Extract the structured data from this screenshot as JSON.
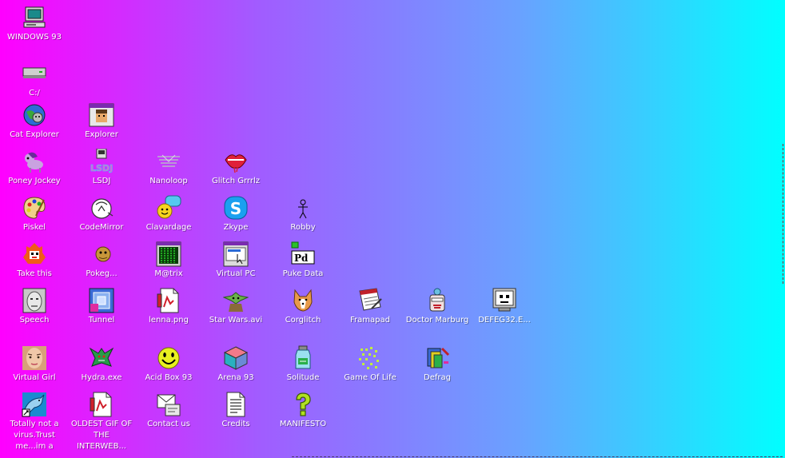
{
  "desktop": {
    "icons": [
      {
        "name": "WINDOWS 93",
        "icon": "computer-icon"
      },
      {
        "name": "C:/",
        "icon": "drive-icon"
      },
      {
        "name": "Cat Explorer",
        "icon": "cat-globe-icon"
      },
      {
        "name": "Explorer",
        "icon": "explorer-window-icon"
      },
      {
        "name": "Poney Jockey",
        "icon": "pony-icon"
      },
      {
        "name": "LSDJ",
        "icon": "gameboy-icon"
      },
      {
        "name": "Nanoloop",
        "icon": "nanoloop-icon"
      },
      {
        "name": "Glitch Grrrlz",
        "icon": "lips-icon"
      },
      {
        "name": "Piskel",
        "icon": "palette-icon"
      },
      {
        "name": "CodeMirror",
        "icon": "codemirror-icon"
      },
      {
        "name": "Clavardage",
        "icon": "chat-smiley-icon"
      },
      {
        "name": "Zkype",
        "icon": "zkype-icon"
      },
      {
        "name": "Robby",
        "icon": "robot-stick-icon"
      },
      {
        "name": "Take this",
        "icon": "fire-creature-icon"
      },
      {
        "name": "Pokeg...",
        "icon": "pokeg-icon"
      },
      {
        "name": "M@trix",
        "icon": "matrix-icon"
      },
      {
        "name": "Virtual PC",
        "icon": "virtual-pc-icon"
      },
      {
        "name": "Puke Data",
        "icon": "puredata-icon"
      },
      {
        "name": "Speech",
        "icon": "face-icon"
      },
      {
        "name": "Tunnel",
        "icon": "tunnel-icon"
      },
      {
        "name": "lenna.png",
        "icon": "image-file-icon"
      },
      {
        "name": "Star Wars.avi",
        "icon": "yoda-icon"
      },
      {
        "name": "Corglitch",
        "icon": "corgi-icon"
      },
      {
        "name": "Framapad",
        "icon": "notepad-icon"
      },
      {
        "name": "Doctor Marburg",
        "icon": "doctor-icon"
      },
      {
        "name": "DEFEG32.E...",
        "icon": "monitor-face-icon"
      },
      {
        "name": "Virtual Girl",
        "icon": "girl-face-icon"
      },
      {
        "name": "Hydra.exe",
        "icon": "dragon-icon"
      },
      {
        "name": "Acid Box 93",
        "icon": "acid-smiley-icon"
      },
      {
        "name": "Arena 93",
        "icon": "cube-icon"
      },
      {
        "name": "Solitude",
        "icon": "jar-icon"
      },
      {
        "name": "Game Of Life",
        "icon": "game-of-life-icon"
      },
      {
        "name": "Defrag",
        "icon": "defrag-icon"
      },
      {
        "name": "Totally not a virus.Trust me...im a",
        "icon": "dolphin-icon"
      },
      {
        "name": "OLDEST GIF OF THE INTERWEB...",
        "icon": "gif-file-icon"
      },
      {
        "name": "Contact us",
        "icon": "contact-icon"
      },
      {
        "name": "Credits",
        "icon": "document-icon"
      },
      {
        "name": "MANIFESTO",
        "icon": "question-icon"
      }
    ]
  },
  "colors": {
    "gradient_left": "#ff00ff",
    "gradient_right": "#00ffff",
    "label_text": "#ffffff"
  }
}
